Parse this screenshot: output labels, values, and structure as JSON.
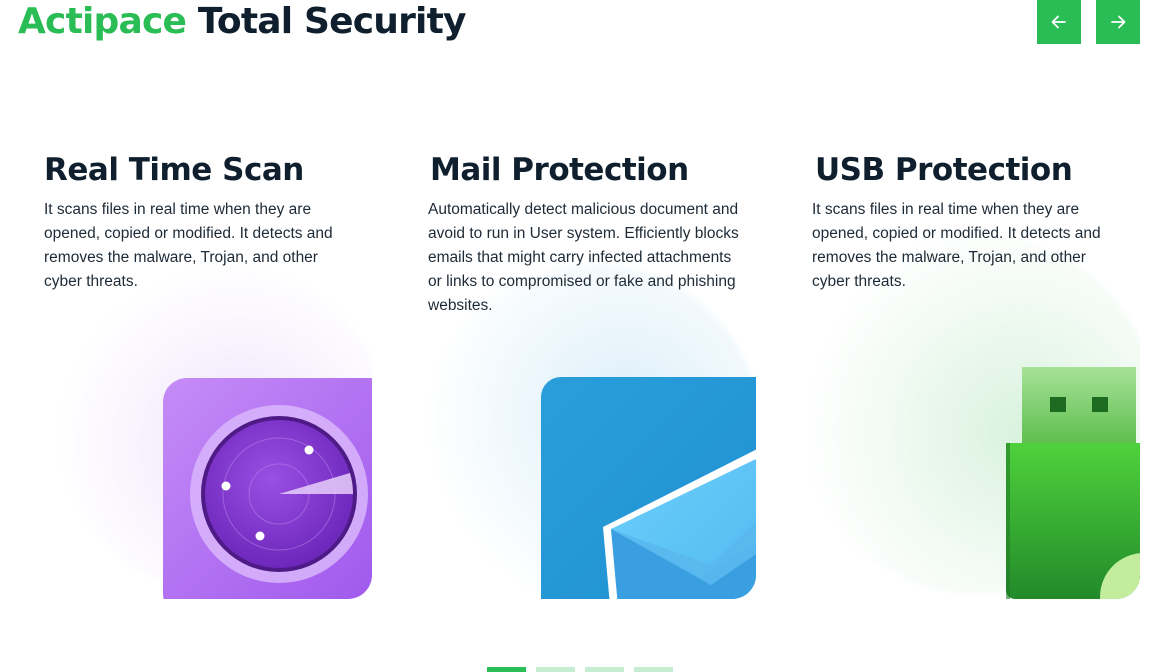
{
  "header": {
    "brand": "Actipace",
    "title_rest": "Total Security"
  },
  "nav": {
    "prev_icon": "arrow-left-icon",
    "next_icon": "arrow-right-icon"
  },
  "cards": [
    {
      "title": "Real Time Scan",
      "description": "It scans files in real time when they are opened, copied or modified. It detects and removes the malware, Trojan, and other cyber threats.",
      "icon": "radar-icon",
      "accent": "#a865f0"
    },
    {
      "title": "Mail Protection",
      "description": "Automatically detect malicious document and avoid to run in User system. Efficiently blocks emails that might carry infected attachments or links to compromised or fake and phishing websites.",
      "icon": "envelope-icon",
      "accent": "#239ad8"
    },
    {
      "title": "USB Protection",
      "description": "It scans files in real time when they are opened, copied or modified. It detects and removes the malware, Trojan, and other cyber threats.",
      "icon": "usb-drive-icon",
      "accent": "#2fb84a"
    }
  ],
  "pagination": {
    "pages": 4,
    "active_page": 1
  },
  "colors": {
    "brand_green": "#2bbd55",
    "inactive_dot": "#c6ecd1",
    "heading": "#0f1f2e"
  }
}
